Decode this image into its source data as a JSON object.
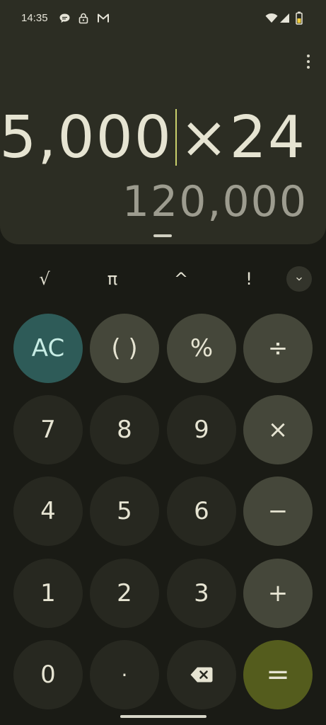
{
  "status_bar": {
    "time": "14:35",
    "left_icons": [
      "chat-bubble-icon",
      "lock-icon",
      "gmail-icon"
    ],
    "right_icons": [
      "wifi-icon",
      "cell-signal-icon",
      "battery-icon"
    ]
  },
  "display": {
    "expression_left": "5,000",
    "expression_right": "×24",
    "result": "120,000"
  },
  "scientific": {
    "sqrt": "√",
    "pi": "π",
    "power": "^",
    "factorial": "!"
  },
  "keys": {
    "ac": "AC",
    "parens": "( )",
    "percent": "%",
    "divide": "÷",
    "seven": "7",
    "eight": "8",
    "nine": "9",
    "multiply": "×",
    "four": "4",
    "five": "5",
    "six": "6",
    "minus": "−",
    "one": "1",
    "two": "2",
    "three": "3",
    "plus": "+",
    "zero": "0",
    "decimal": "·",
    "equals": "="
  },
  "colors": {
    "display_bg": "#2c2d23",
    "screen_bg": "#1a1b15",
    "number_key": "#272820",
    "operator_key": "#45473a",
    "ac_key": "#2e5b58",
    "equals_key": "#545c1d",
    "cursor": "#c9d06b"
  }
}
